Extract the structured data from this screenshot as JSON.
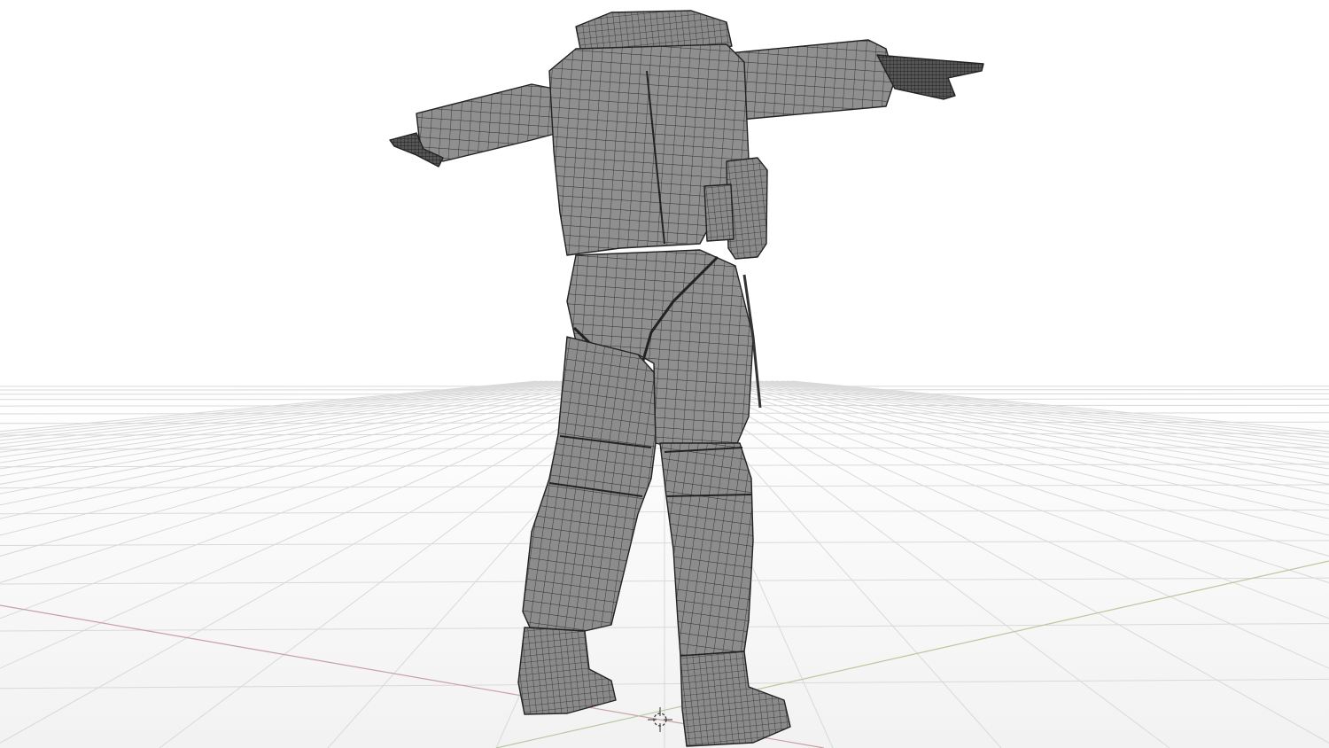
{
  "viewport": {
    "kind": "3d-viewport",
    "object": "wireframe-character-mesh",
    "shading": "solid-with-wireframe",
    "view": "perspective-back-three-quarter",
    "background_top": "#ffffff",
    "background_bottom": "#f4f4f4",
    "grid_color": "#d9d9d9",
    "x_axis_color": "#c8a0a8",
    "y_axis_color": "#b8c8a0",
    "mesh_fill": "#8e8e8e",
    "mesh_wire": "#2b2b2b",
    "cursor_icon": "3d-cursor"
  }
}
